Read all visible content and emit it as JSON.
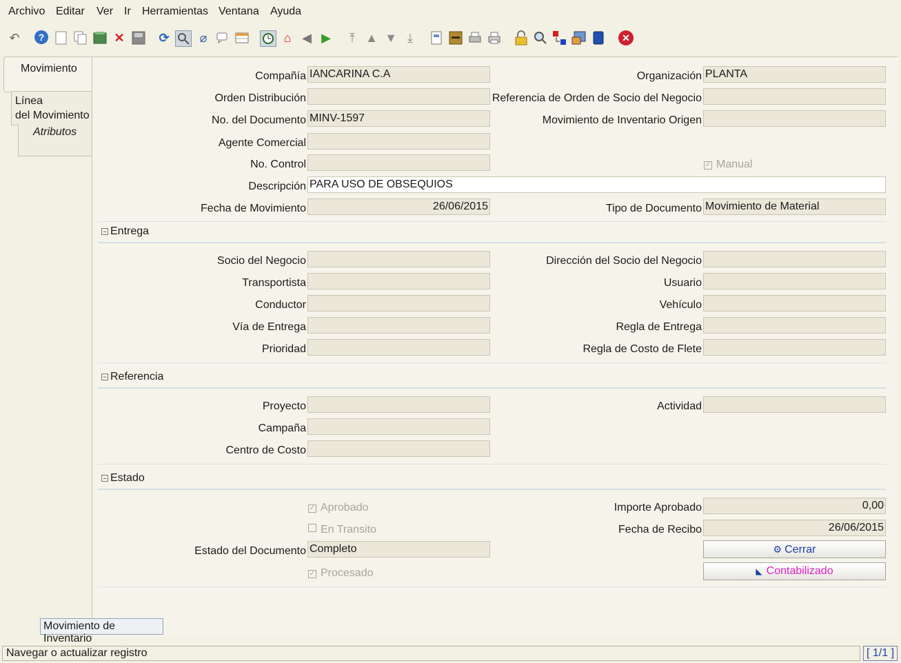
{
  "menu": [
    "Archivo",
    "Editar",
    "Ver",
    "Ir",
    "Herramientas",
    "Ventana",
    "Ayuda"
  ],
  "toolbar_icons": [
    "undo-icon",
    "help-icon",
    "new-icon",
    "copy-icon",
    "save-create-icon",
    "delete-icon",
    "save-icon",
    "refresh-icon",
    "find-icon",
    "attachment-icon",
    "chat-icon",
    "grid-toggle-icon",
    "history-icon",
    "home-icon",
    "back-icon",
    "forward-icon",
    "first-record-icon",
    "previous-record-icon",
    "next-record-icon",
    "last-record-icon",
    "report-icon",
    "archive-icon",
    "print-preview-icon",
    "print-icon",
    "lock-icon",
    "zoom-across-icon",
    "request-icon",
    "product-info-icon",
    "workflow-icon",
    "exit-icon"
  ],
  "tabs": {
    "movimiento": "Movimiento",
    "linea": "Línea\ndel Movimiento",
    "atributos": "Atributos"
  },
  "fields": {
    "compania": {
      "label": "Compañía",
      "value": "IANCARINA C.A"
    },
    "organizacion": {
      "label": "Organización",
      "value": "PLANTA"
    },
    "orden_distribucion": {
      "label": "Orden Distribución",
      "value": ""
    },
    "referencia_orden": {
      "label": "Referencia de Orden de Socio del Negocio",
      "value": ""
    },
    "no_documento": {
      "label": "No. del Documento",
      "value": "MINV-1597"
    },
    "mov_origen": {
      "label": "Movimiento de Inventario Origen",
      "value": ""
    },
    "agente": {
      "label": "Agente Comercial",
      "value": ""
    },
    "no_control": {
      "label": "No. Control",
      "value": ""
    },
    "manual": {
      "label": "Manual",
      "checked": true
    },
    "descripcion": {
      "label": "Descripción",
      "value": "PARA USO DE OBSEQUIOS"
    },
    "fecha_mov": {
      "label": "Fecha de Movimiento",
      "value": "26/06/2015"
    },
    "tipo_doc": {
      "label": "Tipo de Documento",
      "value": "Movimiento de Material"
    }
  },
  "entrega": {
    "title": "Entrega",
    "socio": {
      "label": "Socio del Negocio",
      "value": ""
    },
    "direccion": {
      "label": "Dirección del Socio del Negocio",
      "value": ""
    },
    "transportista": {
      "label": "Transportista",
      "value": ""
    },
    "usuario": {
      "label": "Usuario",
      "value": ""
    },
    "conductor": {
      "label": "Conductor",
      "value": ""
    },
    "vehiculo": {
      "label": "Vehículo",
      "value": ""
    },
    "via": {
      "label": "Vía de Entrega",
      "value": ""
    },
    "regla_entrega": {
      "label": "Regla de Entrega",
      "value": ""
    },
    "prioridad": {
      "label": "Prioridad",
      "value": ""
    },
    "regla_flete": {
      "label": "Regla de Costo de Flete",
      "value": ""
    }
  },
  "referencia": {
    "title": "Referencia",
    "proyecto": {
      "label": "Proyecto",
      "value": ""
    },
    "actividad": {
      "label": "Actividad",
      "value": ""
    },
    "campana": {
      "label": "Campaña",
      "value": ""
    },
    "centro": {
      "label": "Centro de Costo",
      "value": ""
    }
  },
  "estado": {
    "title": "Estado",
    "aprobado": {
      "label": "Aprobado",
      "checked": true
    },
    "importe": {
      "label": "Importe Aprobado",
      "value": "0,00"
    },
    "en_transito": {
      "label": "En Transito",
      "checked": false
    },
    "fecha_recibo": {
      "label": "Fecha de Recibo",
      "value": "26/06/2015"
    },
    "estado_doc": {
      "label": "Estado del Documento",
      "value": "Completo"
    },
    "cerrar": "Cerrar",
    "procesado": {
      "label": "Procesado",
      "checked": true
    },
    "contabilizado": "Contabilizado"
  },
  "tooltip": "Movimiento de Inventario",
  "status": {
    "text": "Navegar o actualizar registro",
    "count": "[ 1/1 ]"
  },
  "colors": {
    "accent_pink": "#e020c0",
    "accent_blue": "#1c3fa8"
  }
}
